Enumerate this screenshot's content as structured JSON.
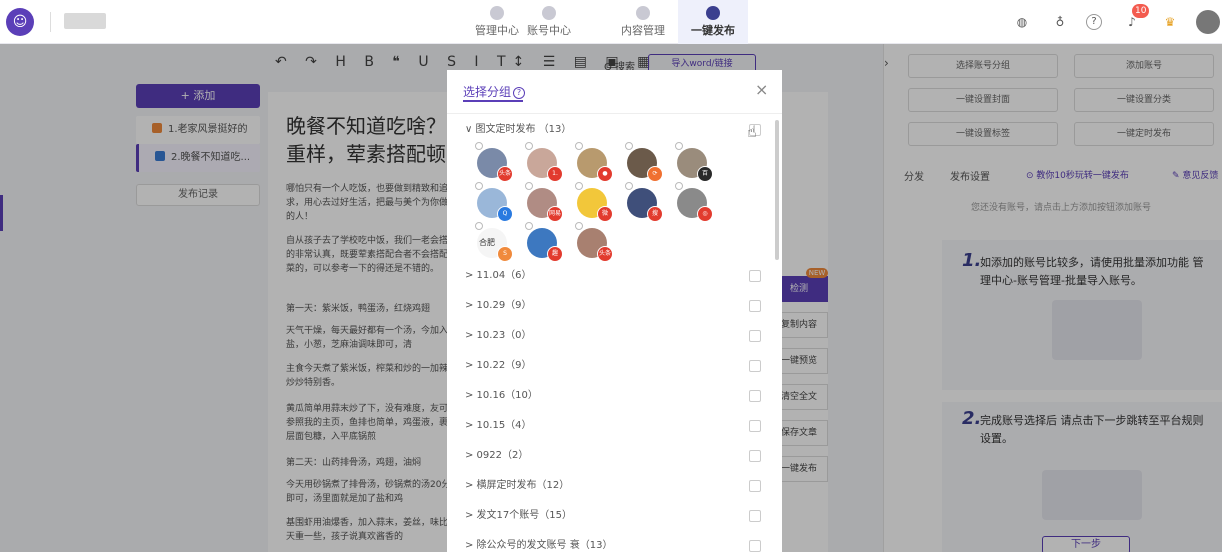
{
  "header": {
    "logo_icon": "robot-icon",
    "nav": [
      {
        "label": "管理中心",
        "active": false
      },
      {
        "label": "账号中心",
        "active": false
      },
      {
        "label": "内容管理",
        "active": false
      },
      {
        "label": "一键发布",
        "active": true
      }
    ],
    "notification_count": "10",
    "accent_color": "#5b3fb8"
  },
  "left": {
    "add_label": "+ 添加",
    "articles": [
      {
        "label": "1.老家风景挺好的",
        "icon_color": "#f08a3c"
      },
      {
        "label": "2.晚餐不知道吃...",
        "icon_color": "#3a7bd5"
      }
    ],
    "history_label": "发布记录"
  },
  "toolbar": {
    "glyphs": "↶ ↷ H B ❝ U S I T↕ ☰ ▤ ▣ ▦",
    "search_label": "Q 搜索",
    "import_label": "导入word/链接"
  },
  "editor": {
    "title": "晚餐不知道吃啥？! 重样，荤素搭配顿",
    "paragraphs": [
      "哪怕只有一个人吃饭，也要做到精致和追求，用心去过好生活，把最与美个为你做饭的人！",
      "自从孩子去了学校吃中饭，我们一老会搭配的非常认真，既要荤素搭配合者不会搭配饭菜的，可以参考一下的得还是不错的。",
      "第一天：紫米饭，鸭蛋汤，红烧鸡翅",
      "天气干燥，每天最好都有一个汤，今加入盐，小葱，芝麻油调味即可，清",
      "主食今天煮了紫米饭，榨菜和炒的一加辣椒炒炒特别香。",
      "黄瓜简单用蒜末炒了下，没有难度，友可以参照我的主页，鱼排也简单，鸡蛋液，裹一层面包糠，入平底锅煎",
      "第二天：山药排骨汤，鸡翅，油焖",
      "今天用砂锅煮了排骨汤，砂锅煮的汤20分钟即可，汤里面就是加了盐和鸡",
      "基围虾用油爆香，加入蒜末，姜丝，味比昨天重一些，孩子说真欢酱香的"
    ]
  },
  "side_actions": [
    {
      "label": "检测",
      "primary": true
    },
    {
      "label": "复制内容",
      "primary": false
    },
    {
      "label": "一键预览",
      "primary": false
    },
    {
      "label": "清空全文",
      "primary": false
    },
    {
      "label": "保存文章",
      "primary": false
    },
    {
      "label": "一键发布",
      "primary": false
    }
  ],
  "new_tag": "NEW",
  "right": {
    "buttons": [
      "选择账号分组",
      "添加账号",
      "一键设置封面",
      "一键设置分类",
      "一键设置标签",
      "一键定时发布"
    ],
    "tabs": [
      "分发",
      "发布设置",
      "⊙ 教你10秒玩转一键发布",
      "✎ 意见反馈"
    ],
    "hint": "您还没有账号，请点击上方添加按钮添加账号",
    "step1_num": "1.",
    "step1_text": "如添加的账号比较多，请使用批量添加功能 管理中心-账号管理-批量导入账号。",
    "step2_num": "2.",
    "step2_text": "完成账号选择后 请点击下一步跳转至平台规则设置。",
    "next_label": "下一步"
  },
  "modal": {
    "title": "选择分组",
    "help": "?",
    "close": "×",
    "expanded_group": "∨ 图文定时发布 （13）",
    "accounts": [
      {
        "color": "#7a8aa8",
        "badge_color": "#e23b2e",
        "badge_text": "头条"
      },
      {
        "color": "#c9a79a",
        "badge_color": "#e23b2e",
        "badge_text": "1."
      },
      {
        "color": "#b89a6e",
        "badge_color": "#e23b2e",
        "badge_text": "●"
      },
      {
        "color": "#6b5a4a",
        "badge_color": "#f07030",
        "badge_text": "⟳"
      },
      {
        "color": "#9a8c7c",
        "badge_color": "#2a2a2a",
        "badge_text": "百"
      },
      {
        "color": "#9ab7d9",
        "badge_color": "#2a7ae0",
        "badge_text": "Q"
      },
      {
        "color": "#b08c84",
        "badge_color": "#e23b2e",
        "badge_text": "网易"
      },
      {
        "color": "#f2c73a",
        "badge_color": "#e23b2e",
        "badge_text": "微"
      },
      {
        "color": "#3f4f7a",
        "badge_color": "#e23b2e",
        "badge_text": "搜"
      },
      {
        "color": "#8a8a8a",
        "badge_color": "#e23b2e",
        "badge_text": "◎"
      },
      {
        "color": "#f5f5f5",
        "badge_color": "#f08a3c",
        "badge_text": "S",
        "label": "合肥"
      },
      {
        "color": "#3d78c0",
        "badge_color": "#e23b2e",
        "badge_text": "趣"
      },
      {
        "color": "#a88070",
        "badge_color": "#e23b2e",
        "badge_text": "头条"
      }
    ],
    "groups": [
      "> 11.04（6）",
      "> 10.29（9）",
      "> 10.23（0）",
      "> 10.22（9）",
      "> 10.16（10）",
      "> 10.15（4）",
      "> 0922（2）",
      "> 横屏定时发布（12）",
      "> 发文17个账号（15）",
      "> 除公众号的发文账号 衰（13）"
    ]
  }
}
